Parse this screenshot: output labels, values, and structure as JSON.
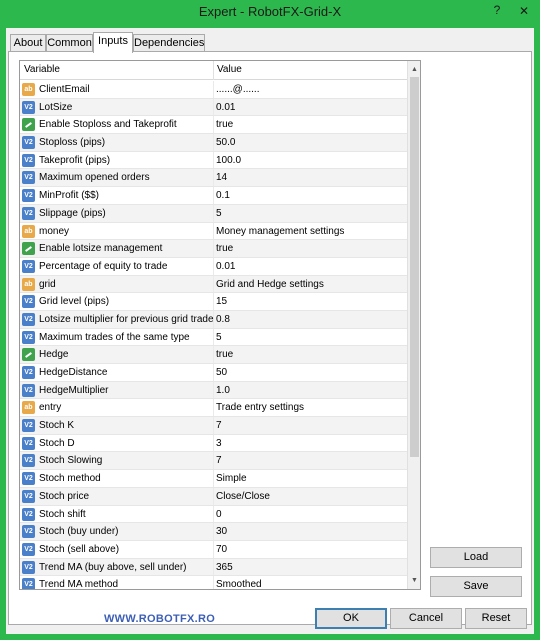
{
  "window": {
    "title": "Expert - RobotFX-Grid-X",
    "help_glyph": "?",
    "close_glyph": "✕"
  },
  "tabs": [
    {
      "label": "About"
    },
    {
      "label": "Common"
    },
    {
      "label": "Inputs"
    },
    {
      "label": "Dependencies"
    }
  ],
  "table": {
    "headers": {
      "variable": "Variable",
      "value": "Value"
    },
    "rows": [
      {
        "icon": "ab",
        "name": "ClientEmail",
        "value": "......@......"
      },
      {
        "icon": "v2",
        "name": "LotSize",
        "value": "0.01"
      },
      {
        "icon": "bool",
        "name": "Enable Stoploss and Takeprofit",
        "value": "true"
      },
      {
        "icon": "v2",
        "name": "Stoploss (pips)",
        "value": "50.0"
      },
      {
        "icon": "v2",
        "name": "Takeprofit (pips)",
        "value": "100.0"
      },
      {
        "icon": "v2",
        "name": "Maximum opened orders",
        "value": "14"
      },
      {
        "icon": "v2",
        "name": "MinProfit ($$)",
        "value": "0.1"
      },
      {
        "icon": "v2",
        "name": "Slippage (pips)",
        "value": "5"
      },
      {
        "icon": "ab",
        "name": "money",
        "value": "Money management settings"
      },
      {
        "icon": "bool",
        "name": "Enable lotsize management",
        "value": "true"
      },
      {
        "icon": "v2",
        "name": "Percentage of equity to trade",
        "value": "0.01"
      },
      {
        "icon": "ab",
        "name": "grid",
        "value": "Grid and Hedge settings"
      },
      {
        "icon": "v2",
        "name": "Grid level (pips)",
        "value": "15"
      },
      {
        "icon": "v2",
        "name": "Lotsize multiplier for previous grid trade",
        "value": "0.8"
      },
      {
        "icon": "v2",
        "name": "Maximum trades of the same type",
        "value": "5"
      },
      {
        "icon": "bool",
        "name": "Hedge",
        "value": "true"
      },
      {
        "icon": "v2",
        "name": "HedgeDistance",
        "value": "50"
      },
      {
        "icon": "v2",
        "name": "HedgeMultiplier",
        "value": "1.0"
      },
      {
        "icon": "ab",
        "name": "entry",
        "value": "Trade entry settings"
      },
      {
        "icon": "v2",
        "name": "Stoch K",
        "value": "7"
      },
      {
        "icon": "v2",
        "name": "Stoch D",
        "value": "3"
      },
      {
        "icon": "v2",
        "name": "Stoch Slowing",
        "value": "7"
      },
      {
        "icon": "v2",
        "name": "Stoch method",
        "value": "Simple"
      },
      {
        "icon": "v2",
        "name": "Stoch price",
        "value": "Close/Close"
      },
      {
        "icon": "v2",
        "name": "Stoch shift",
        "value": "0"
      },
      {
        "icon": "v2",
        "name": "Stoch (buy under)",
        "value": "30"
      },
      {
        "icon": "v2",
        "name": "Stoch (sell above)",
        "value": "70"
      },
      {
        "icon": "v2",
        "name": "Trend MA (buy above, sell under)",
        "value": "365"
      },
      {
        "icon": "v2",
        "name": "Trend MA method",
        "value": "Smoothed"
      }
    ]
  },
  "side_buttons": {
    "load": "Load",
    "save": "Save"
  },
  "footer": {
    "brand": "WWW.ROBOTFX.RO",
    "ok": "OK",
    "cancel": "Cancel",
    "reset": "Reset"
  },
  "colors": {
    "titlebar": "#2db84d",
    "brand": "#3c5eb5"
  }
}
